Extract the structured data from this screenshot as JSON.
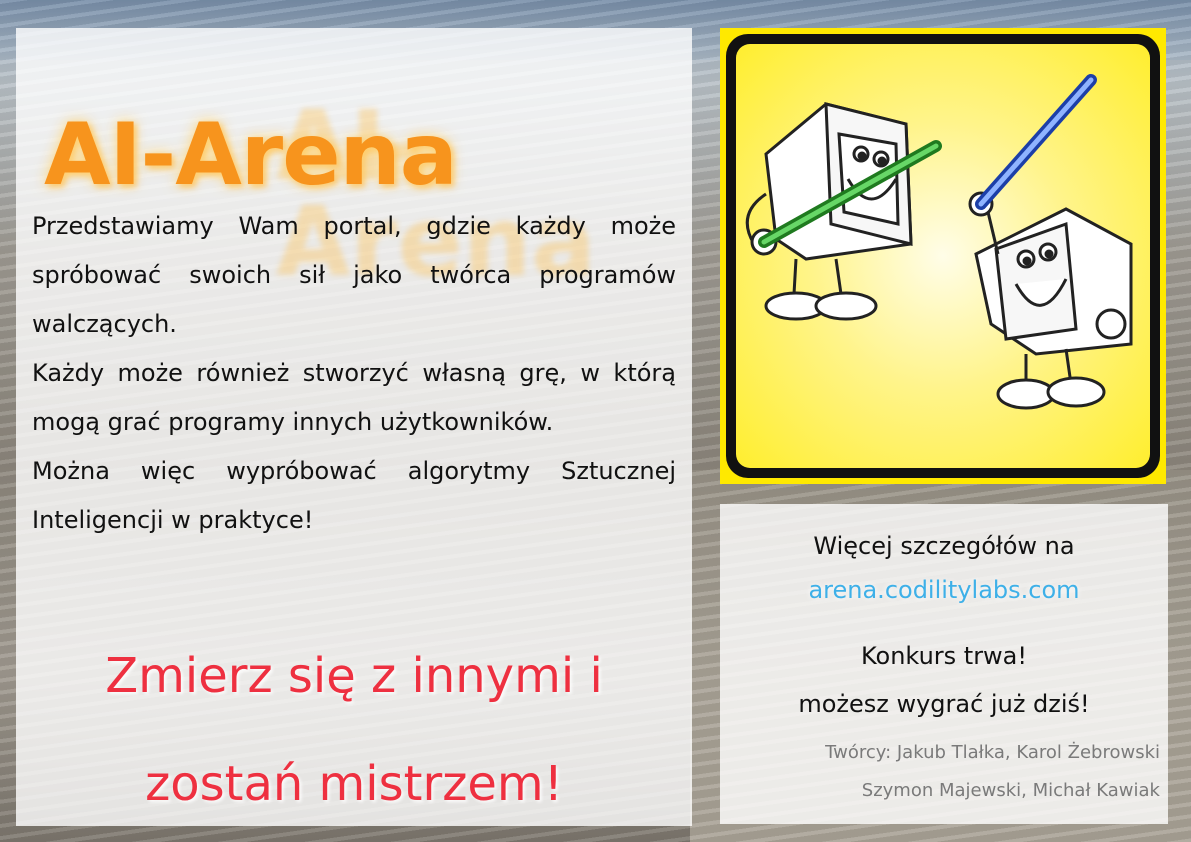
{
  "brand": {
    "title": "AI-Arena"
  },
  "description": {
    "paragraphs": [
      "Przedstawiamy Wam portal, gdzie każdy może spróbować swoich sił jako twórca programów walczących.",
      "Każdy może również stworzyć własną grę, w którą mogą grać programy innych użytkowników.",
      "Można więc wypróbować algorytmy Sztucznej Inteligencji w praktyce!"
    ]
  },
  "slogan": {
    "line1": "Zmierz się z innymi i",
    "line2": "zostań mistrzem!"
  },
  "illustration": {
    "icon": "computers-lightsaber-duel-illustration",
    "colors": {
      "background": "#ffe900",
      "frame": "#111111",
      "green_saber": "#2ea82e",
      "blue_saber": "#2f5fd0"
    }
  },
  "info": {
    "more_details": "Więcej szczegółów na",
    "link": "arena.codilitylabs.com",
    "contest": "Konkurs trwa!",
    "win": "możesz wygrać już dziś!"
  },
  "credits": {
    "line1": "Twórcy: Jakub Tlałka, Karol Żebrowski",
    "line2": "Szymon Majewski, Michał Kawiak"
  },
  "colors": {
    "title_orange": "#f7941d",
    "slogan_red": "#ee3040",
    "link_blue": "#3eb0e8",
    "credits_gray": "#7a7a7a"
  }
}
